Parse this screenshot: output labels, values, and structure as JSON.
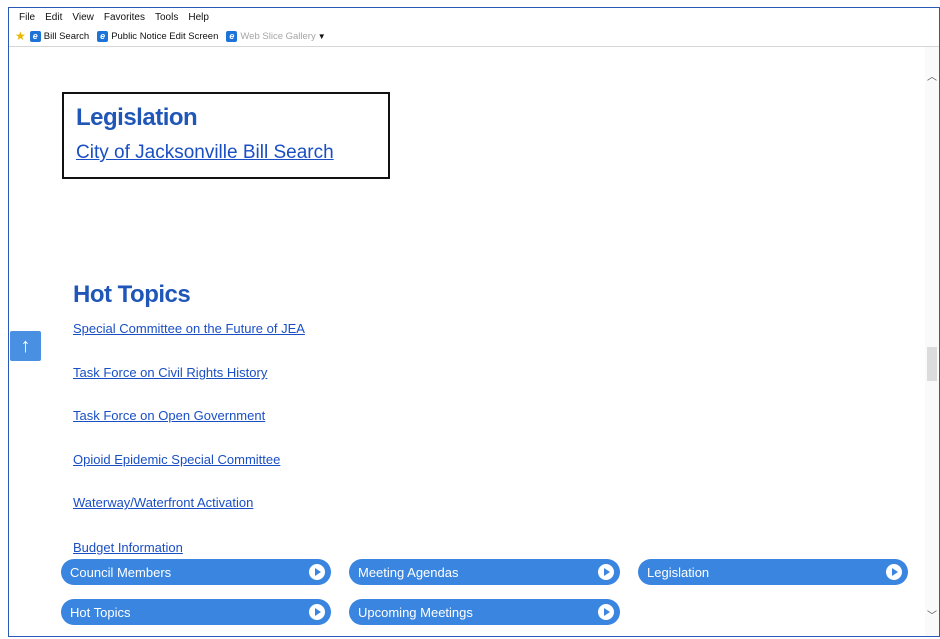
{
  "menu": [
    "File",
    "Edit",
    "View",
    "Favorites",
    "Tools",
    "Help"
  ],
  "favorites": {
    "items": [
      {
        "label": "Bill Search"
      },
      {
        "label": "Public Notice Edit Screen"
      },
      {
        "label": "Web Slice Gallery"
      }
    ]
  },
  "legislation": {
    "title": "Legislation",
    "link": "City of Jacksonville Bill Search"
  },
  "hot_topics": {
    "title": "Hot Topics",
    "links": [
      "Special Committee on the Future of JEA",
      "Task Force on Civil Rights History",
      "Task Force on Open Government",
      "Opioid Epidemic Special Committee",
      "Waterway/Waterfront Activation",
      "Budget Information"
    ]
  },
  "nav_buttons": [
    "Council Members",
    "Meeting Agendas",
    "Legislation",
    "Hot Topics",
    "Upcoming Meetings"
  ],
  "icons": {
    "favorites": "star-icon",
    "page": "ie-page-icon",
    "back_to_top": "arrow-up-icon",
    "scroll_up": "chevron-up-icon",
    "scroll_down": "chevron-down-icon"
  },
  "colors": {
    "heading": "#1f56b8",
    "link": "#1a4fc4",
    "pill": "#3a85df",
    "back_to_top": "#4a90e2",
    "frame_border": "#2a59b8"
  }
}
